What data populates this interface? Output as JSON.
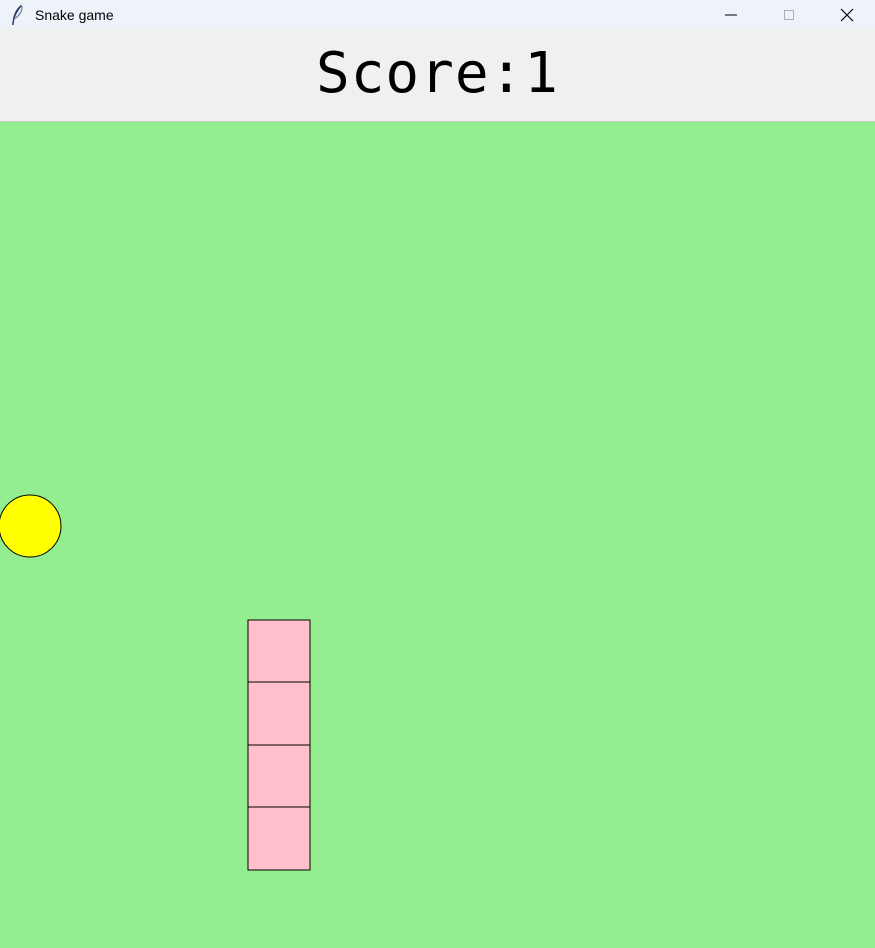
{
  "window": {
    "title": "Snake game",
    "icon": "feather-icon"
  },
  "controls": {
    "minimize_icon": "minimize-icon",
    "maximize_icon": "maximize-icon",
    "close_icon": "close-icon"
  },
  "score": {
    "label": "Score:1"
  },
  "board": {
    "background": "#93ee90",
    "food_color": "#ffff00",
    "snake_color": "#ffc0cb",
    "snake_length": 4
  }
}
